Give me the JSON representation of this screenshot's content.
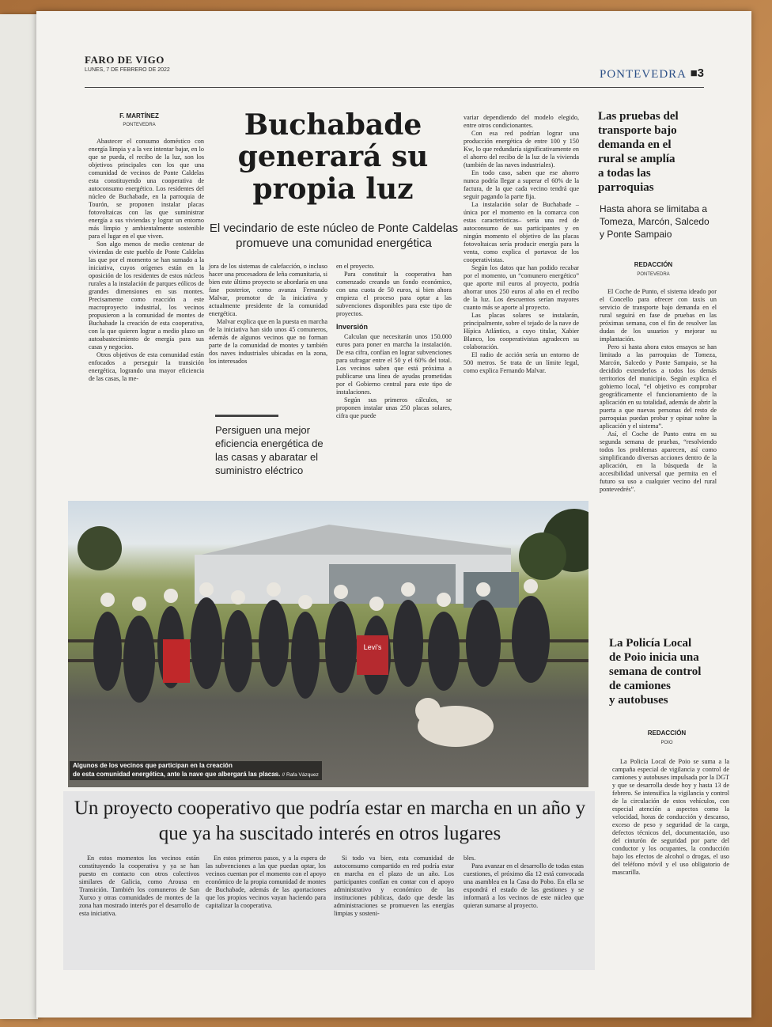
{
  "masthead": {
    "paper": "FARO DE VIGO",
    "date": "LUNES, 7 DE FEBRERO DE 2022",
    "section": "PONTEVEDRA",
    "page": "■3"
  },
  "main": {
    "byline": "F. MARTÍNEZ",
    "place": "PONTEVEDRA",
    "headline": [
      "Buchabade",
      "generará su",
      "propia luz"
    ],
    "subhead": [
      "El vecindario de este núcleo de Ponte Caldelas",
      "promueve una comunidad energética"
    ],
    "col1": [
      "Abastecer el consumo doméstico con energía limpia y a la vez intentar bajar, en lo que se pueda, el recibo de la luz, son los objetivos principales con los que una comunidad de vecinos de Ponte Caldelas esta constituyendo una cooperativa de autoconsumo energético. Los residentes del núcleo de Buchabade, en la parroquia de Tourón, se proponen instalar placas fotovoltaicas con las que suministrar energía a sus viviendas y lograr un entorno más limpio y ambientalmente sostenible para el lugar en el que viven.",
      "Son algo menos de medio centenar de viviendas de este pueblo de Ponte Caldelas las que por el momento se han sumado a la iniciativa, cuyos orígenes están en la oposición de los residentes de estos núcleos rurales a la instalación de parques eólicos de grandes dimensiones en sus montes. Precisamente como reacción a este macroproyecto industrial, los vecinos propusieron a la comunidad de montes de Buchabade la creación de esta cooperativa, con la que quieren lograr a medio plazo un autoabastecimiento de energía para sus casas y negocios.",
      "Otros objetivos de esta comunidad están enfocados a perseguir la transición energética, logrando una mayor eficiencia de las casas, la me-"
    ],
    "col2": [
      "jora de los sistemas de calefacción, o incluso hacer una procesadora de leña comunitaria, si bien este último proyecto se abordaría en una fase posterior, como avanza Fernando Malvar, promotor de la iniciativa y actualmente presidente de la comunidad energética.",
      "Malvar explica que en la puesta en marcha de la iniciativa han sido unos 45 comuneros, además de algunos vecinos que no forman parte de la comunidad de montes y también dos naves industriales ubicadas en la zona, los interesados"
    ],
    "quote": "Persiguen una mejor eficiencia energética de las casas y abaratar el suministro eléctrico",
    "col3a": [
      "en el proyecto.",
      "Para constituir la cooperativa han comenzado creando un fondo económico, con una cuota de 50 euros, si bien ahora empieza el proceso para optar a las subvenciones disponibles para este tipo de proyectos."
    ],
    "subtitle": "Inversión",
    "col3b": [
      "Calculan que necesitarán unos 150.000 euros para poner en marcha la instalación. De esa cifra, confían en lograr subvenciones para sufragar entre el 50 y el 60% del total. Los vecinos saben que está próxima a publicarse una línea de ayudas prometidas por el Gobierno central para este tipo de instalaciones.",
      "Según sus primeros cálculos, se proponen instalar unas 250 placas solares, cifra que puede"
    ],
    "col4": [
      "variar dependiendo del modelo elegido, entre otros condicionantes.",
      "Con esa red podrían lograr una producción energética de entre 100 y 150 Kw, lo que redundaría significativamente en el ahorro del recibo de la luz de la vivienda (también de las naves industriales).",
      "En todo caso, saben que ese ahorro nunca podría llegar a superar el 60% de la factura, de la que cada vecino tendrá que seguir pagando la parte fija.",
      "La instalación solar de Buchabade –única por el momento en la comarca con estas características– sería una red de autoconsumo de sus participantes y en ningún momento el objetivo de las placas fotovoltaicas sería producir energía para la venta, como explica el portavoz de los cooperativistas.",
      "Según los datos que han podido recabar por el momento, un “comunero energético” que aporte mil euros al proyecto, podría ahorrar unos 250 euros al año en el recibo de la luz. Los descuentos serían mayores cuanto más se aporte al proyecto.",
      "Las placas solares se instalarán, principalmente, sobre el tejado de la nave de Hípica Atlántico, a cuyo titular, Xabier Blanco, los cooperativistas agradecen su colaboración.",
      "El radio de acción sería un entorno de 500 metros. Se trata de un límite legal, como explica Fernando Malvar."
    ],
    "caption": [
      "Algunos de los vecinos que participan en la creación",
      "de esta comunidad energética, ante la nave que albergará las placas."
    ],
    "credit": "// Rafa Vázquez",
    "photo_sign": "Levi's"
  },
  "bottom": {
    "headline": "Un proyecto cooperativo que podría estar en marcha en un año y que ya ha suscitado interés en otros lugares",
    "col1": "En estos momentos los vecinos están constituyendo la cooperativa y ya se han puesto en contacto con otros colectivos similares de Galicia, como Arousa en Transición. También los comuneros de San Xurxo y otras comunidades de montes de la zona han mostrado interés por el desarrollo de esta iniciativa.",
    "col2": "En estos primeros pasos, y a la espera de las subvenciones a las que puedan optar, los vecinos cuentan por el momento con el apoyo económico de la propia comunidad de montes de Buchabade, además de las aportaciones que los propios vecinos vayan haciendo para capitalizar la cooperativa.",
    "col3": "Si todo va bien, esta comunidad de autoconsumo compartido en red podría estar en marcha en el plazo de un año. Los participantes confían en contar con el apoyo administrativo y económico de las instituciones públicas, dado que desde las administraciones se promueven las energías limpias y sosteni-",
    "col4": [
      "bles.",
      "Para avanzar en el desarrollo de todas estas cuestiones, el próximo día 12 está convocada una asamblea en la Casa do Pobo. En ella se expondrá el estado de las gestiones y se informará a los vecinos de este núcleo que quieran sumarse al proyecto."
    ]
  },
  "side1": {
    "headline": [
      "Las pruebas del",
      "transporte bajo",
      "demanda en el",
      "rural se amplía",
      "a todas las",
      "parroquias"
    ],
    "deck": "Hasta ahora se limitaba a Tomeza, Marcón, Salcedo y Ponte Sampaio",
    "byline": "REDACCIÓN",
    "place": "PONTEVEDRA",
    "body": [
      "El Coche de Punto, el sistema ideado por el Concello para ofrecer con taxis un servicio de transporte bajo demanda en el rural seguirá en fase de pruebas en las próximas semana, con el fin de resolver las dudas de los usuarios y mejorar su implantación.",
      "Pero si hasta ahora estos ensayos se han limitado a las parroquias de Tomeza, Marcón, Salcedo y Ponte Sampaio, se ha decidido extenderlos a todos los demás territorios del municipio. Según explica el gobierno local, “el objetivo es comprobar geográficamente el funcionamiento de la aplicación en su totalidad, además de abrir la puerta a que nuevas personas del resto de parroquias puedan probar y opinar sobre la aplicación y el sistema”.",
      "Así, el Coche de Punto entra en su segunda semana de pruebas, “resolviendo todos los problemas aparecen, así como simplificando diversas acciones dentro de la aplicación, en la búsqueda de la accesibilidad universal que permita en el futuro su uso a cualquier vecino del rural pontevedrés”."
    ]
  },
  "side2": {
    "headline": [
      "La Policía Local",
      "de Poio inicia una",
      "semana de control",
      "de camiones",
      "y autobuses"
    ],
    "byline": "REDACCIÓN",
    "place": "POIO",
    "body": [
      "La Policía Local de Poio se suma a la campaña especial de vigilancia y control de camiones y autobuses impulsada por la DGT y que se desarrolla desde hoy y hasta 13 de febrero. Se intensifica la vigilancia y control de la circulación de estos vehículos, con especial atención a aspectos como la velocidad, horas de conducción y descanso, exceso de peso y seguridad de la carga, defectos técnicos del, documentación, uso del cinturón de seguridad por parte del conductor y los ocupantes, la conducción bajo los efectos de alcohol o drogas, el uso del teléfono móvil y el uso obligatorio de mascarilla."
    ]
  },
  "colors": {
    "section_blue": "#2b4f86",
    "paper": "#f3f2ee",
    "box_gray": "#e5e5e6"
  }
}
